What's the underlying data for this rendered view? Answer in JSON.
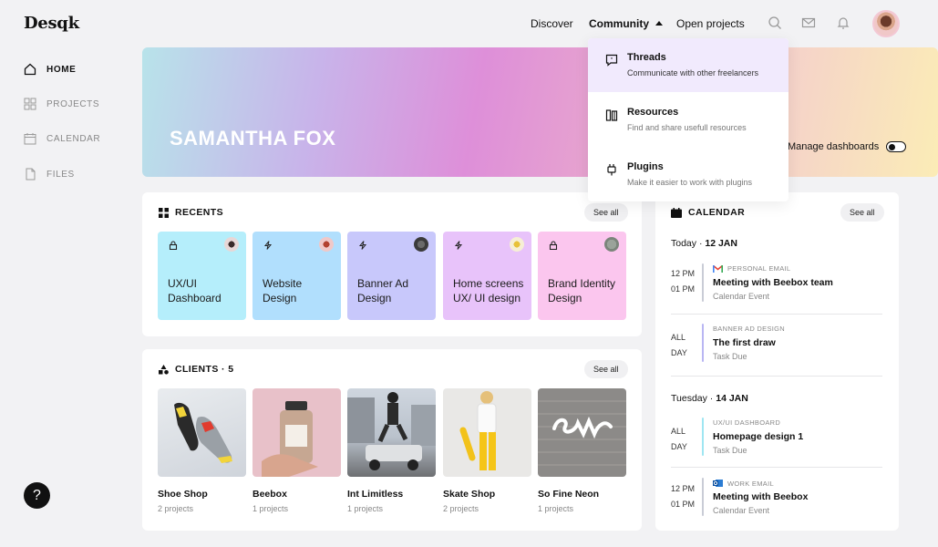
{
  "brand": "Desqk",
  "topnav": {
    "discover": "Discover",
    "community": "Community",
    "open_projects": "Open projects",
    "icons": [
      "search-icon",
      "mail-icon",
      "bell-icon"
    ]
  },
  "sidebar": {
    "items": [
      {
        "label": "HOME",
        "icon": "home-icon",
        "active": true
      },
      {
        "label": "PROJECTS",
        "icon": "grid-icon",
        "active": false
      },
      {
        "label": "CALENDAR",
        "icon": "calendar-icon",
        "active": false
      },
      {
        "label": "FILES",
        "icon": "file-icon",
        "active": false
      }
    ],
    "help": "?"
  },
  "hero": {
    "name": "SAMANTHA FOX",
    "manage_label": "Manage dashboards"
  },
  "dropdown": {
    "items": [
      {
        "title": "Threads",
        "desc": "Communicate with other freelancers",
        "icon": "quote-icon"
      },
      {
        "title": "Resources",
        "desc": "Find and share usefull resources",
        "icon": "books-icon"
      },
      {
        "title": "Plugins",
        "desc": "Make it easier to work with plugins",
        "icon": "plug-icon"
      }
    ]
  },
  "recents": {
    "title": "RECENTS",
    "see_all": "See all",
    "items": [
      {
        "label": "UX/UI Dashboard",
        "icon": "lock-icon",
        "color": "#b5eefb"
      },
      {
        "label": "Website Design",
        "icon": "bolt-icon",
        "color": "#b1dffd"
      },
      {
        "label": "Banner Ad Design",
        "icon": "bolt-icon",
        "color": "#c8c8fb"
      },
      {
        "label": "Home screens UX/ UI design",
        "icon": "bolt-icon",
        "color": "#e8c3fa"
      },
      {
        "label": "Brand Identity Design",
        "icon": "lock-icon",
        "color": "#fbc6ee"
      }
    ]
  },
  "clients": {
    "title": "CLIENTS",
    "count": "5",
    "see_all": "See all",
    "items": [
      {
        "name": "Shoe Shop",
        "projects": "2 projects"
      },
      {
        "name": "Beebox",
        "projects": "1 projects"
      },
      {
        "name": "Int Limitless",
        "projects": "1 projects"
      },
      {
        "name": "Skate Shop",
        "projects": "2 projects"
      },
      {
        "name": "So Fine Neon",
        "projects": "1 projects"
      }
    ]
  },
  "calendar": {
    "title": "CALENDAR",
    "see_all": "See all",
    "days": [
      {
        "day": "Today",
        "date": "12 JAN",
        "events": [
          {
            "time1": "12 PM",
            "time2": "01 PM",
            "tag": "PERSONAL EMAIL",
            "title": "Meeting with Beebox team",
            "sub": "Calendar Event",
            "bar_color": "#c9ccd6",
            "tag_icon": "gmail-icon"
          },
          {
            "time1": "ALL",
            "time2": "DAY",
            "tag": "BANNER AD DESIGN",
            "title": "The first draw",
            "sub": "Task Due",
            "bar_color": "#b9b6f3"
          }
        ]
      },
      {
        "day": "Tuesday",
        "date": "14 JAN",
        "events": [
          {
            "time1": "ALL",
            "time2": "DAY",
            "tag": "UX/UI DASHBOARD",
            "title": "Homepage design 1",
            "sub": "Task Due",
            "bar_color": "#9fe6f2"
          },
          {
            "time1": "12 PM",
            "time2": "01 PM",
            "tag": "WORK EMAIL",
            "title": "Meeting with Beebox",
            "sub": "Calendar Event",
            "bar_color": "#c9ccd6",
            "tag_icon": "outlook-icon"
          }
        ]
      }
    ]
  }
}
